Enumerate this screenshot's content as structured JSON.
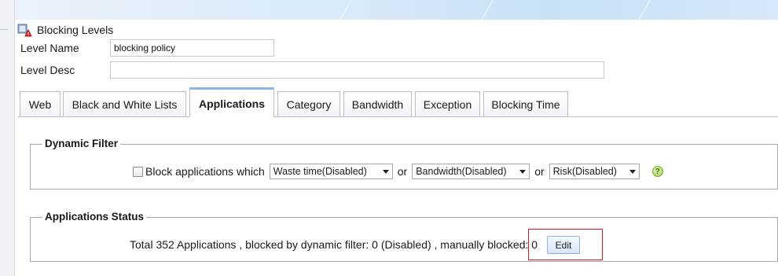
{
  "header": {
    "title": "Blocking Levels"
  },
  "form": {
    "level_name_label": "Level Name",
    "level_name_value": "blocking policy",
    "level_desc_label": "Level Desc",
    "level_desc_value": ""
  },
  "tabs": [
    {
      "label": "Web"
    },
    {
      "label": "Black and White Lists"
    },
    {
      "label": "Applications"
    },
    {
      "label": "Category"
    },
    {
      "label": "Bandwidth"
    },
    {
      "label": "Exception"
    },
    {
      "label": "Blocking Time"
    }
  ],
  "active_tab": "Applications",
  "dynamic_filter": {
    "legend": "Dynamic Filter",
    "checkbox_label": "Block applications which",
    "checked": false,
    "or_1": "or",
    "or_2": "or",
    "select_waste": "Waste time(Disabled)",
    "select_bandwidth": "Bandwidth(Disabled)",
    "select_risk": "Risk(Disabled)",
    "help_icon": "question-icon"
  },
  "applications_status": {
    "legend": "Applications Status",
    "summary": "Total 352 Applications , blocked by dynamic filter: 0 (Disabled) , manually blocked: 0",
    "edit_label": "Edit"
  },
  "colors": {
    "active_tab_accent": "#86b7e8",
    "highlight_border": "#e0151b"
  }
}
